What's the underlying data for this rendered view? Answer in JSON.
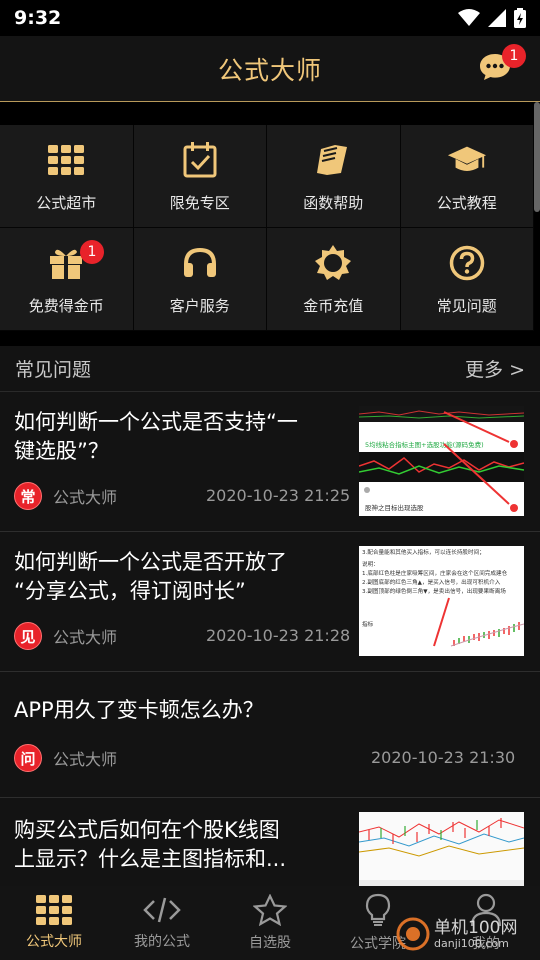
{
  "status_bar": {
    "time": "9:32"
  },
  "header": {
    "title": "公式大师",
    "message_badge": "1"
  },
  "grid": [
    {
      "label": "公式超市",
      "icon": "grid-icon"
    },
    {
      "label": "限免专区",
      "icon": "calendar-check-icon"
    },
    {
      "label": "函数帮助",
      "icon": "book-icon"
    },
    {
      "label": "公式教程",
      "icon": "graduation-cap-icon"
    },
    {
      "label": "免费得金币",
      "icon": "gift-icon",
      "badge": "1"
    },
    {
      "label": "客户服务",
      "icon": "headset-icon"
    },
    {
      "label": "金币充值",
      "icon": "sun-icon"
    },
    {
      "label": "常见问题",
      "icon": "question-icon"
    }
  ],
  "faq": {
    "title": "常见问题",
    "more": "更多 >",
    "articles": [
      {
        "title_line1": "如何判断一个公式是否支持“一",
        "title_line2": "键选股”？",
        "avatar": "常",
        "author": "公式大师",
        "date": "2020-10-23 21:25"
      },
      {
        "title_line1": "如何判断一个公式是否开放了",
        "title_line2": "“分享公式，得订阅时长”",
        "avatar": "见",
        "author": "公式大师",
        "date": "2020-10-23 21:28"
      },
      {
        "title_line1": "APP用久了变卡顿怎么办？",
        "title_line2": "",
        "avatar": "问",
        "author": "公式大师",
        "date": "2020-10-23 21:30"
      },
      {
        "title_line1": "购买公式后如何在个股K线图",
        "title_line2": "上显示？什么是主图指标和...",
        "avatar": "",
        "author": "",
        "date": ""
      }
    ]
  },
  "thumb_text": {
    "t1_line1": "5均线粘合指标主图+选股功能(源码免费)",
    "t1_line2": "股神之目标出现选股",
    "t2_line1": "3.配合量能和其他买入指标，可以连长持股时间；",
    "t2_line2": "说明：",
    "t2_line3": "1.底部红色柱是庄家吸筹区间，庄家会在这个区间完成建仓",
    "t2_line4": "2.副图底部的红色三角▲，是买入信号，出现可积机介入",
    "t2_line5": "3.副图顶部的绿色倒三角▼，是卖出信号，出现要果断离场",
    "t2_line6": "指标"
  },
  "nav": [
    {
      "label": "公式大师",
      "icon": "grid-icon",
      "active": true
    },
    {
      "label": "我的公式",
      "icon": "code-icon"
    },
    {
      "label": "自选股",
      "icon": "star-icon"
    },
    {
      "label": "公式学院",
      "icon": "bulb-icon"
    },
    {
      "label": "我的",
      "icon": "user-icon"
    }
  ],
  "watermark": {
    "line1": "单机100网",
    "line2": "danji100.com"
  },
  "colors": {
    "accent": "#f0c77a",
    "badge": "#e8232a",
    "background": "#000000",
    "panel": "#1a1a1a"
  }
}
